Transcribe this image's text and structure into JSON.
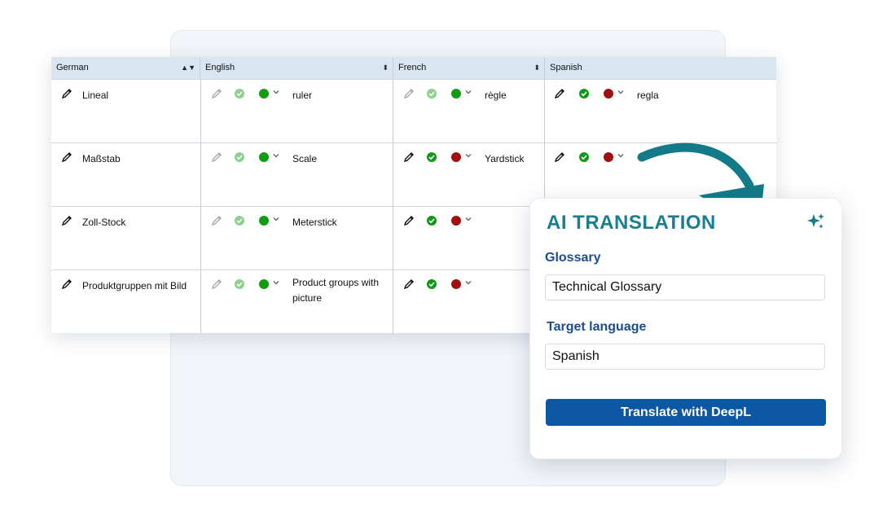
{
  "columns": [
    "German",
    "English",
    "French",
    "Spanish"
  ],
  "rows": [
    {
      "german": "Lineal",
      "english": "ruler",
      "french": "règle",
      "spanish": "regla"
    },
    {
      "german": "Maßstab",
      "english": "Scale",
      "french": "Yardstick",
      "spanish": ""
    },
    {
      "german": "Zoll-Stock",
      "english": "Meterstick",
      "french": "",
      "spanish": ""
    },
    {
      "german": "Produktgruppen mit Bild",
      "english": "Product groups with picture",
      "french": "",
      "spanish": ""
    }
  ],
  "panel": {
    "title": "AI TRANSLATION",
    "glossary_label": "Glossary",
    "glossary_value": "Technical Glossary",
    "target_label": "Target language",
    "target_value": "Spanish",
    "button_label": "Translate with DeepL"
  },
  "colors": {
    "header_bg": "#d9e6f2",
    "title": "#167f91",
    "label": "#1c4d8c",
    "button": "#0b57a4",
    "status_green": "#129c12",
    "status_red": "#a10f0f",
    "arrow": "#137a8a"
  },
  "icons": [
    "pencil-icon",
    "check-circle-icon",
    "status-dot-icon",
    "chevron-down-icon",
    "sort-icon",
    "sparkle-icon",
    "curved-arrow-icon"
  ]
}
